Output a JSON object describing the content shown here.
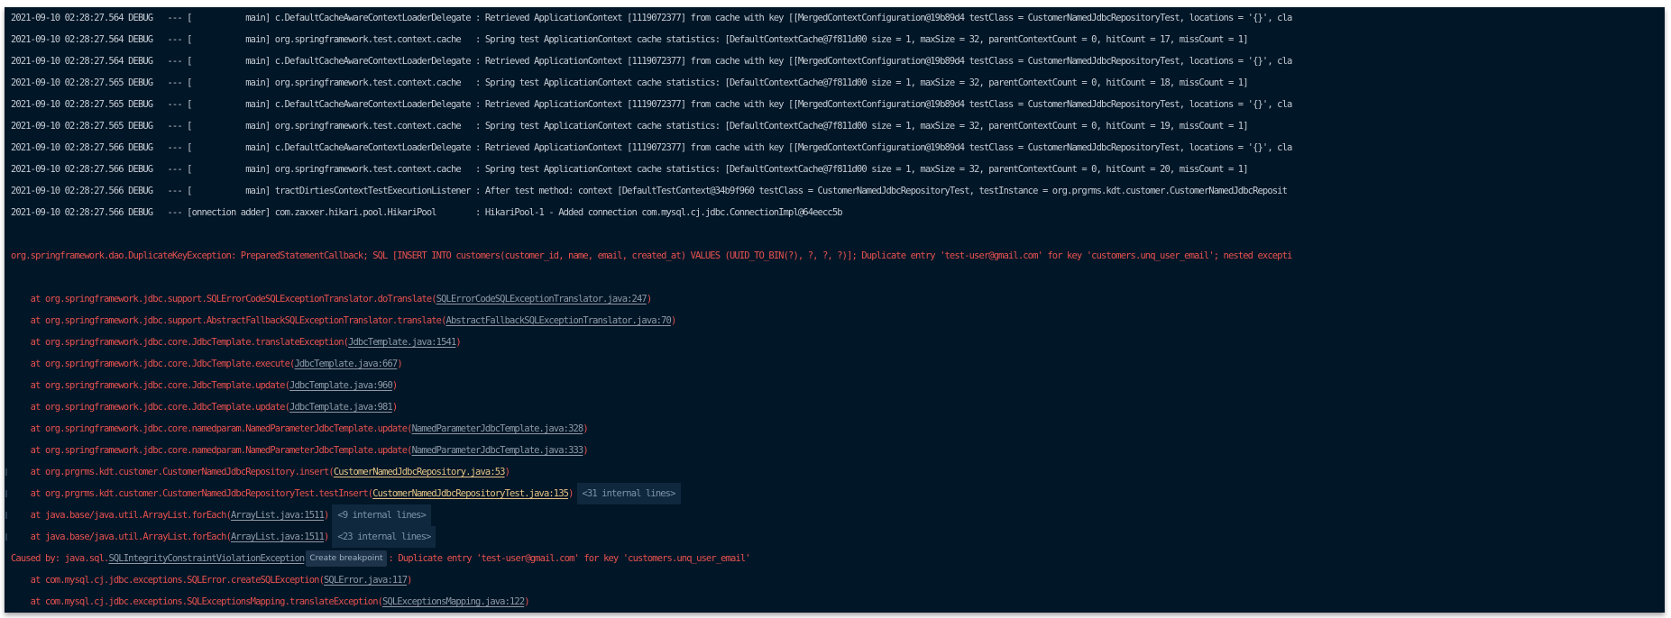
{
  "colors": {
    "background": "#011627",
    "log_text": "#c5ccd4",
    "error": "#e8514f",
    "link": "#8e99a6",
    "user_link": "#e6c384",
    "fold_chip": "#10283e"
  },
  "debug_lines": [
    {
      "prefix": "2021-09-10 02:28:27.564 DEBUG   --- [           main] c.DefaultCacheAwareContextLoaderDelegate : ",
      "message": "Retrieved ApplicationContext [1119072377] from cache with key [[MergedContextConfiguration@19b89d4 testClass = CustomerNamedJdbcRepositoryTest, locations = '{}', cla"
    },
    {
      "prefix": "2021-09-10 02:28:27.564 DEBUG   --- [           main] org.springframework.test.context.cache   : ",
      "message": "Spring test ApplicationContext cache statistics: [DefaultContextCache@7f811d00 size = 1, maxSize = 32, parentContextCount = 0, hitCount = 17, missCount = 1]"
    },
    {
      "prefix": "2021-09-10 02:28:27.564 DEBUG   --- [           main] c.DefaultCacheAwareContextLoaderDelegate : ",
      "message": "Retrieved ApplicationContext [1119072377] from cache with key [[MergedContextConfiguration@19b89d4 testClass = CustomerNamedJdbcRepositoryTest, locations = '{}', cla"
    },
    {
      "prefix": "2021-09-10 02:28:27.565 DEBUG   --- [           main] org.springframework.test.context.cache   : ",
      "message": "Spring test ApplicationContext cache statistics: [DefaultContextCache@7f811d00 size = 1, maxSize = 32, parentContextCount = 0, hitCount = 18, missCount = 1]"
    },
    {
      "prefix": "2021-09-10 02:28:27.565 DEBUG   --- [           main] c.DefaultCacheAwareContextLoaderDelegate : ",
      "message": "Retrieved ApplicationContext [1119072377] from cache with key [[MergedContextConfiguration@19b89d4 testClass = CustomerNamedJdbcRepositoryTest, locations = '{}', cla"
    },
    {
      "prefix": "2021-09-10 02:28:27.565 DEBUG   --- [           main] org.springframework.test.context.cache   : ",
      "message": "Spring test ApplicationContext cache statistics: [DefaultContextCache@7f811d00 size = 1, maxSize = 32, parentContextCount = 0, hitCount = 19, missCount = 1]"
    },
    {
      "prefix": "2021-09-10 02:28:27.566 DEBUG   --- [           main] c.DefaultCacheAwareContextLoaderDelegate : ",
      "message": "Retrieved ApplicationContext [1119072377] from cache with key [[MergedContextConfiguration@19b89d4 testClass = CustomerNamedJdbcRepositoryTest, locations = '{}', cla"
    },
    {
      "prefix": "2021-09-10 02:28:27.566 DEBUG   --- [           main] org.springframework.test.context.cache   : ",
      "message": "Spring test ApplicationContext cache statistics: [DefaultContextCache@7f811d00 size = 1, maxSize = 32, parentContextCount = 0, hitCount = 20, missCount = 1]"
    },
    {
      "prefix": "2021-09-10 02:28:27.566 DEBUG   --- [           main] tractDirtiesContextTestExecutionListener : ",
      "message": "After test method: context [DefaultTestContext@34b9f960 testClass = CustomerNamedJdbcRepositoryTest, testInstance = org.prgrms.kdt.customer.CustomerNamedJdbcReposit"
    },
    {
      "prefix": "2021-09-10 02:28:27.566 DEBUG   --- [onnection adder] com.zaxxer.hikari.pool.HikariPool        : ",
      "message": "HikariPool-1 - Added connection com.mysql.cj.jdbc.ConnectionImpl@64eecc5b"
    }
  ],
  "exception": "org.springframework.dao.DuplicateKeyException: PreparedStatementCallback; SQL [INSERT INTO customers(customer_id, name, email, created_at) VALUES (UUID_TO_BIN(?), ?, ?, ?)]; Duplicate entry 'test-user@gmail.com' for key 'customers.unq_user_email'; nested excepti",
  "frames": [
    {
      "at": "    at org.springframework.jdbc.support.SQLErrorCodeSQLExceptionTranslator.doTranslate",
      "link": "SQLErrorCodeSQLExceptionTranslator.java:247"
    },
    {
      "at": "    at org.springframework.jdbc.support.AbstractFallbackSQLExceptionTranslator.translate",
      "link": "AbstractFallbackSQLExceptionTranslator.java:70"
    },
    {
      "at": "    at org.springframework.jdbc.core.JdbcTemplate.translateException",
      "link": "JdbcTemplate.java:1541"
    },
    {
      "at": "    at org.springframework.jdbc.core.JdbcTemplate.execute",
      "link": "JdbcTemplate.java:667"
    },
    {
      "at": "    at org.springframework.jdbc.core.JdbcTemplate.update",
      "link": "JdbcTemplate.java:960"
    },
    {
      "at": "    at org.springframework.jdbc.core.JdbcTemplate.update",
      "link": "JdbcTemplate.java:981"
    },
    {
      "at": "    at org.springframework.jdbc.core.namedparam.NamedParameterJdbcTemplate.update",
      "link": "NamedParameterJdbcTemplate.java:328"
    },
    {
      "at": "    at org.springframework.jdbc.core.namedparam.NamedParameterJdbcTemplate.update",
      "link": "NamedParameterJdbcTemplate.java:333"
    },
    {
      "at": "    at org.prgrms.kdt.customer.CustomerNamedJdbcRepository.insert",
      "link": "CustomerNamedJdbcRepository.java:53",
      "user": true
    },
    {
      "at": "    at org.prgrms.kdt.customer.CustomerNamedJdbcRepositoryTest.testInsert",
      "link": "CustomerNamedJdbcRepositoryTest.java:135",
      "user": true,
      "folded": "<31 internal lines>"
    },
    {
      "at": "    at java.base/java.util.ArrayList.forEach",
      "link": "ArrayList.java:1511",
      "folded": "<9 internal lines>"
    },
    {
      "at": "    at java.base/java.util.ArrayList.forEach",
      "link": "ArrayList.java:1511",
      "folded": "<23 internal lines>"
    }
  ],
  "caused_by": {
    "prefix": "Caused by: java.sql.",
    "class_link": "SQLIntegrityConstraintViolationException",
    "breakpoint_label": "Create breakpoint",
    "message": ": Duplicate entry 'test-user@gmail.com' for key 'customers.unq_user_email'"
  },
  "caused_frames": [
    {
      "at": "    at com.mysql.cj.jdbc.exceptions.SQLError.createSQLException",
      "link": "SQLError.java:117"
    },
    {
      "at": "    at com.mysql.cj.jdbc.exceptions.SQLExceptionsMapping.translateException",
      "link": "SQLExceptionsMapping.java:122"
    }
  ]
}
